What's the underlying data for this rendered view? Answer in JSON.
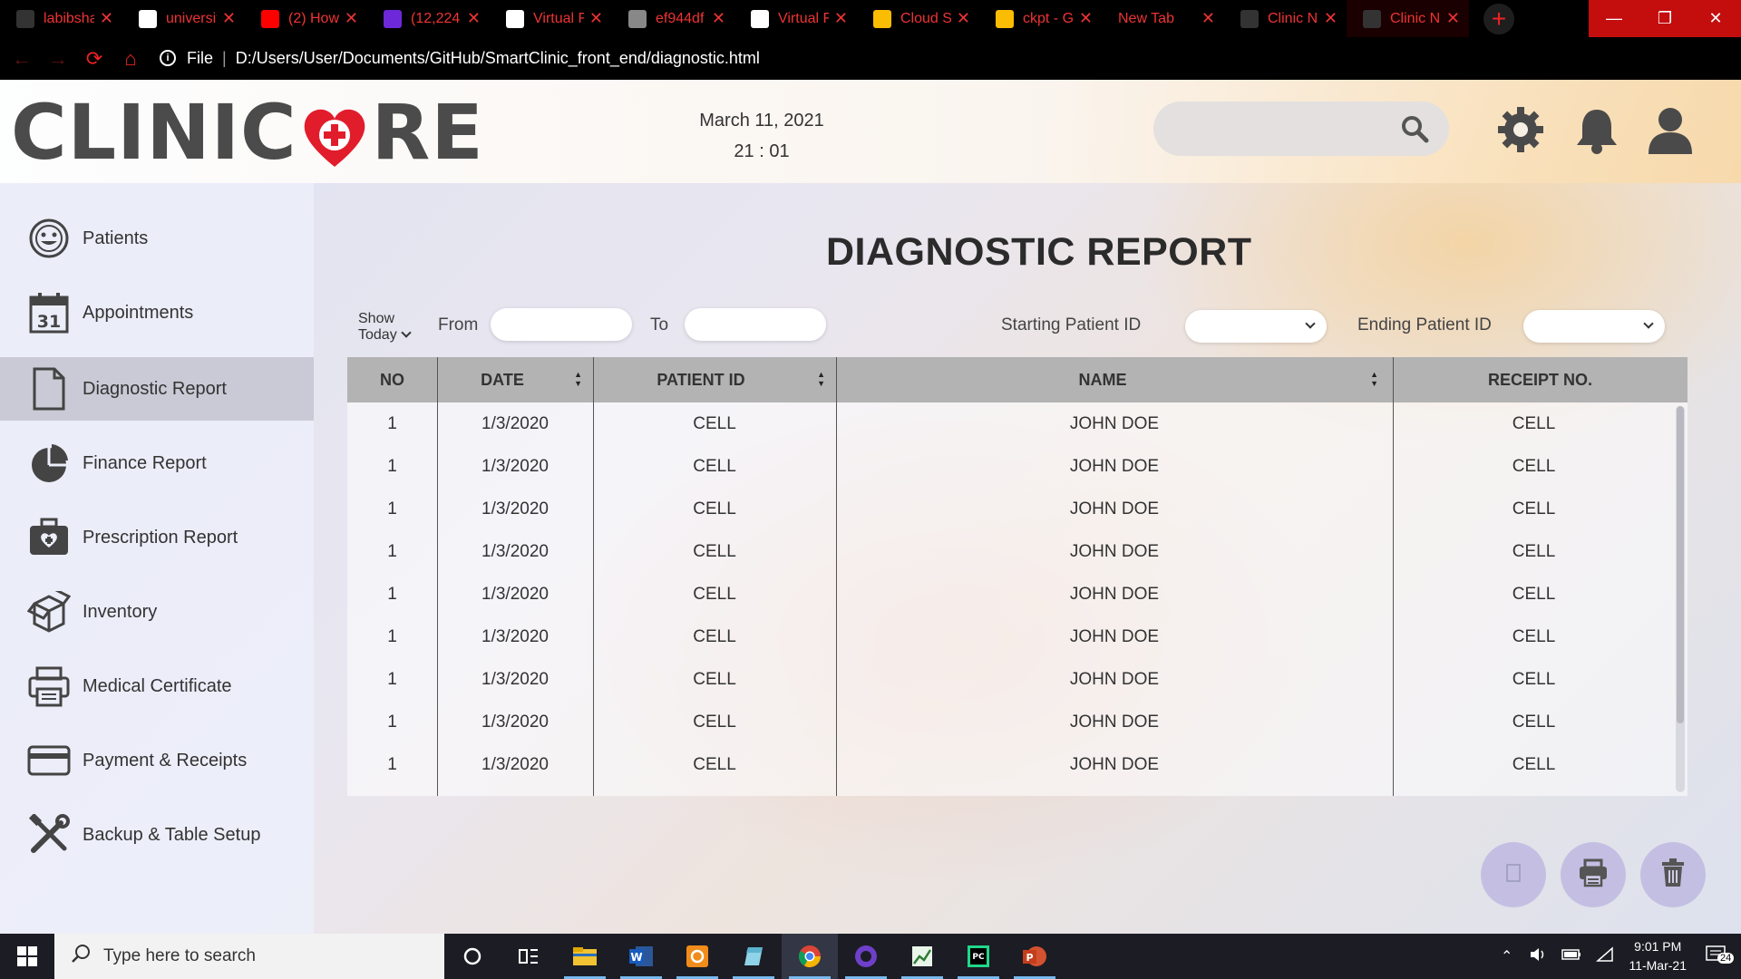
{
  "browser": {
    "tabs": [
      {
        "title": "labibsha",
        "icon": "github-icon"
      },
      {
        "title": "universit",
        "icon": "google-icon"
      },
      {
        "title": "(2) How",
        "icon": "youtube-icon"
      },
      {
        "title": "(12,224",
        "icon": "mail-icon"
      },
      {
        "title": "Virtual F",
        "icon": "site-icon"
      },
      {
        "title": "ef944df",
        "icon": "globe-icon"
      },
      {
        "title": "Virtual F",
        "icon": "site-icon"
      },
      {
        "title": "Cloud St",
        "icon": "drive-icon"
      },
      {
        "title": "ckpt - G",
        "icon": "drive-icon"
      },
      {
        "title": "New Tab",
        "icon": ""
      },
      {
        "title": "Clinic N",
        "icon": "github-icon"
      },
      {
        "title": "Clinic N",
        "icon": "github-icon"
      }
    ],
    "address": {
      "scheme": "File",
      "url": "D:/Users/User/Documents/GitHub/SmartClinic_front_end/diagnostic.html"
    }
  },
  "header": {
    "logo_left": "CLINIC",
    "logo_right": "RE",
    "date": "March 11, 2021",
    "time": "21 : 01",
    "search_placeholder": ""
  },
  "sidebar": {
    "items": [
      {
        "label": "Patients",
        "icon": "smiley-face-icon"
      },
      {
        "label": "Appointments",
        "icon": "calendar-icon",
        "calendar_day": "31"
      },
      {
        "label": "Diagnostic Report",
        "icon": "document-icon",
        "active": true
      },
      {
        "label": "Finance Report",
        "icon": "pie-chart-icon"
      },
      {
        "label": "Prescription Report",
        "icon": "medical-kit-icon"
      },
      {
        "label": "Inventory",
        "icon": "box-icon"
      },
      {
        "label": "Medical Certificate",
        "icon": "printer-icon"
      },
      {
        "label": "Payment & Receipts",
        "icon": "credit-card-icon"
      },
      {
        "label": "Backup & Table Setup",
        "icon": "tools-icon"
      }
    ]
  },
  "report": {
    "title": "DIAGNOSTIC REPORT",
    "filters": {
      "show_line1": "Show",
      "show_line2": "Today",
      "from_label": "From",
      "to_label": "To",
      "start_label": "Starting Patient ID",
      "end_label": "Ending Patient ID"
    },
    "columns": [
      "NO",
      "DATE",
      "PATIENT ID",
      "NAME",
      "RECEIPT NO."
    ],
    "rows": [
      [
        "1",
        "1/3/2020",
        "CELL",
        "JOHN DOE",
        "CELL"
      ],
      [
        "1",
        "1/3/2020",
        "CELL",
        "JOHN DOE",
        "CELL"
      ],
      [
        "1",
        "1/3/2020",
        "CELL",
        "JOHN DOE",
        "CELL"
      ],
      [
        "1",
        "1/3/2020",
        "CELL",
        "JOHN DOE",
        "CELL"
      ],
      [
        "1",
        "1/3/2020",
        "CELL",
        "JOHN DOE",
        "CELL"
      ],
      [
        "1",
        "1/3/2020",
        "CELL",
        "JOHN DOE",
        "CELL"
      ],
      [
        "1",
        "1/3/2020",
        "CELL",
        "JOHN DOE",
        "CELL"
      ],
      [
        "1",
        "1/3/2020",
        "CELL",
        "JOHN DOE",
        "CELL"
      ],
      [
        "1",
        "1/3/2020",
        "CELL",
        "JOHN DOE",
        "CELL"
      ]
    ]
  },
  "actions": {
    "icons": [
      "blank-page-icon",
      "printer-icon",
      "trash-icon"
    ]
  },
  "taskbar": {
    "search_placeholder": "Type here to search",
    "time": "9:01 PM",
    "date": "11-Mar-21",
    "notification_count": "24"
  },
  "colors": {
    "accent": "#e11d2b",
    "chrome": "#000000",
    "header_bg": "#b3b3b3",
    "fab": "#beb9e1"
  }
}
